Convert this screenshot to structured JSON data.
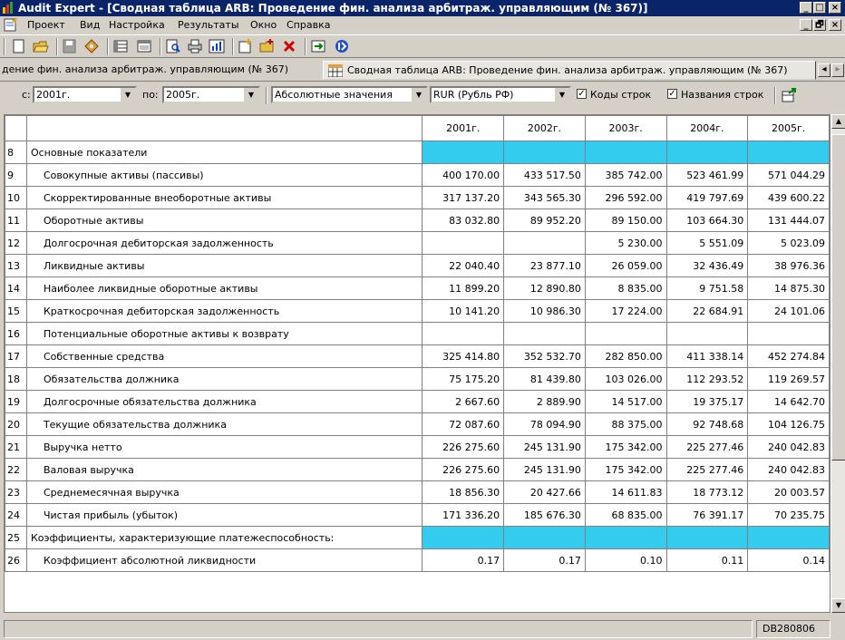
{
  "window": {
    "title": "Audit Expert - [Сводная таблица ARB: Проведение фин. анализа арбитраж. управляющим (№ 367)]",
    "min": "_",
    "max": "□",
    "close": "×"
  },
  "doc_controls": {
    "min": "_",
    "restore": "🗗",
    "close": "×"
  },
  "menu": [
    "Проект",
    "Вид",
    "Настройка",
    "Результаты",
    "Окно",
    "Справка"
  ],
  "tabs": [
    {
      "label": "дение фин. анализа арбитраж. управляющим (№ 367)"
    },
    {
      "label": "Сводная таблица ARB: Проведение фин. анализа арбитраж. управляющим (№ 367)"
    }
  ],
  "filter": {
    "from_label": "с:",
    "from_value": "2001г.",
    "to_label": "по:",
    "to_value": "2005г.",
    "mode_value": "Абсолютные значения",
    "currency_value": "RUR (Рубль РФ)",
    "codes_label": "Коды строк",
    "codes_checked": "✓",
    "names_label": "Названия строк",
    "names_checked": "✓"
  },
  "table": {
    "columns": [
      "2001г.",
      "2002г.",
      "2003г.",
      "2004г.",
      "2005г."
    ],
    "rows": [
      {
        "n": "8",
        "label": "Основные показатели",
        "section": true,
        "values": [
          "",
          "",
          "",
          "",
          ""
        ]
      },
      {
        "n": "9",
        "label": "Совокупные активы (пассивы)",
        "values": [
          "400 170.00",
          "433 517.50",
          "385 742.00",
          "523 461.99",
          "571 044.29"
        ]
      },
      {
        "n": "10",
        "label": "Скорректированные внеоборотные активы",
        "values": [
          "317 137.20",
          "343 565.30",
          "296 592.00",
          "419 797.69",
          "439 600.22"
        ]
      },
      {
        "n": "11",
        "label": "Оборотные активы",
        "values": [
          "83 032.80",
          "89 952.20",
          "89 150.00",
          "103 664.30",
          "131 444.07"
        ]
      },
      {
        "n": "12",
        "label": "Долгосрочная дебиторская задолженность",
        "values": [
          "",
          "",
          "5 230.00",
          "5 551.09",
          "5 023.09"
        ]
      },
      {
        "n": "13",
        "label": "Ликвидные активы",
        "values": [
          "22 040.40",
          "23 877.10",
          "26 059.00",
          "32 436.49",
          "38 976.36"
        ]
      },
      {
        "n": "14",
        "label": "Наиболее ликвидные оборотные активы",
        "values": [
          "11 899.20",
          "12 890.80",
          "8 835.00",
          "9 751.58",
          "14 875.30"
        ]
      },
      {
        "n": "15",
        "label": "Краткосрочная дебиторская задолженность",
        "values": [
          "10 141.20",
          "10 986.30",
          "17 224.00",
          "22 684.91",
          "24 101.06"
        ]
      },
      {
        "n": "16",
        "label": "Потенциальные оборотные активы к возврату",
        "values": [
          "",
          "",
          "",
          "",
          ""
        ]
      },
      {
        "n": "17",
        "label": "Собственные средства",
        "values": [
          "325 414.80",
          "352 532.70",
          "282 850.00",
          "411 338.14",
          "452 274.84"
        ]
      },
      {
        "n": "18",
        "label": "Обязательства должника",
        "values": [
          "75 175.20",
          "81 439.80",
          "103 026.00",
          "112 293.52",
          "119 269.57"
        ]
      },
      {
        "n": "19",
        "label": "Долгосрочные обязательства должника",
        "values": [
          "2 667.60",
          "2 889.90",
          "14 517.00",
          "19 375.17",
          "14 642.70"
        ]
      },
      {
        "n": "20",
        "label": "Текущие обязательства должника",
        "values": [
          "72 087.60",
          "78 094.90",
          "88 375.00",
          "92 748.68",
          "104 126.75"
        ]
      },
      {
        "n": "21",
        "label": "Выручка нетто",
        "values": [
          "226 275.60",
          "245 131.90",
          "175 342.00",
          "225 277.46",
          "240 042.83"
        ]
      },
      {
        "n": "22",
        "label": "Валовая выручка",
        "values": [
          "226 275.60",
          "245 131.90",
          "175 342.00",
          "225 277.46",
          "240 042.83"
        ]
      },
      {
        "n": "23",
        "label": "Среднемесячная выручка",
        "values": [
          "18 856.30",
          "20 427.66",
          "14 611.83",
          "18 773.12",
          "20 003.57"
        ]
      },
      {
        "n": "24",
        "label": "Чистая прибыль (убыток)",
        "values": [
          "171 336.20",
          "185 676.30",
          "68 835.00",
          "76 391.17",
          "70 235.75"
        ]
      },
      {
        "n": "25",
        "label": "Коэффициенты, характеризующие платежеспособность:",
        "section": true,
        "values": [
          "",
          "",
          "",
          "",
          ""
        ]
      },
      {
        "n": "26",
        "label": "Коэффициент абсолютной ликвидности",
        "values": [
          "0.17",
          "0.17",
          "0.10",
          "0.11",
          "0.14"
        ]
      }
    ]
  },
  "status": {
    "code": "DB280806"
  },
  "colors": {
    "titlebar": "#0a246a",
    "section": "#33ccee",
    "chrome": "#d4d0c8"
  }
}
